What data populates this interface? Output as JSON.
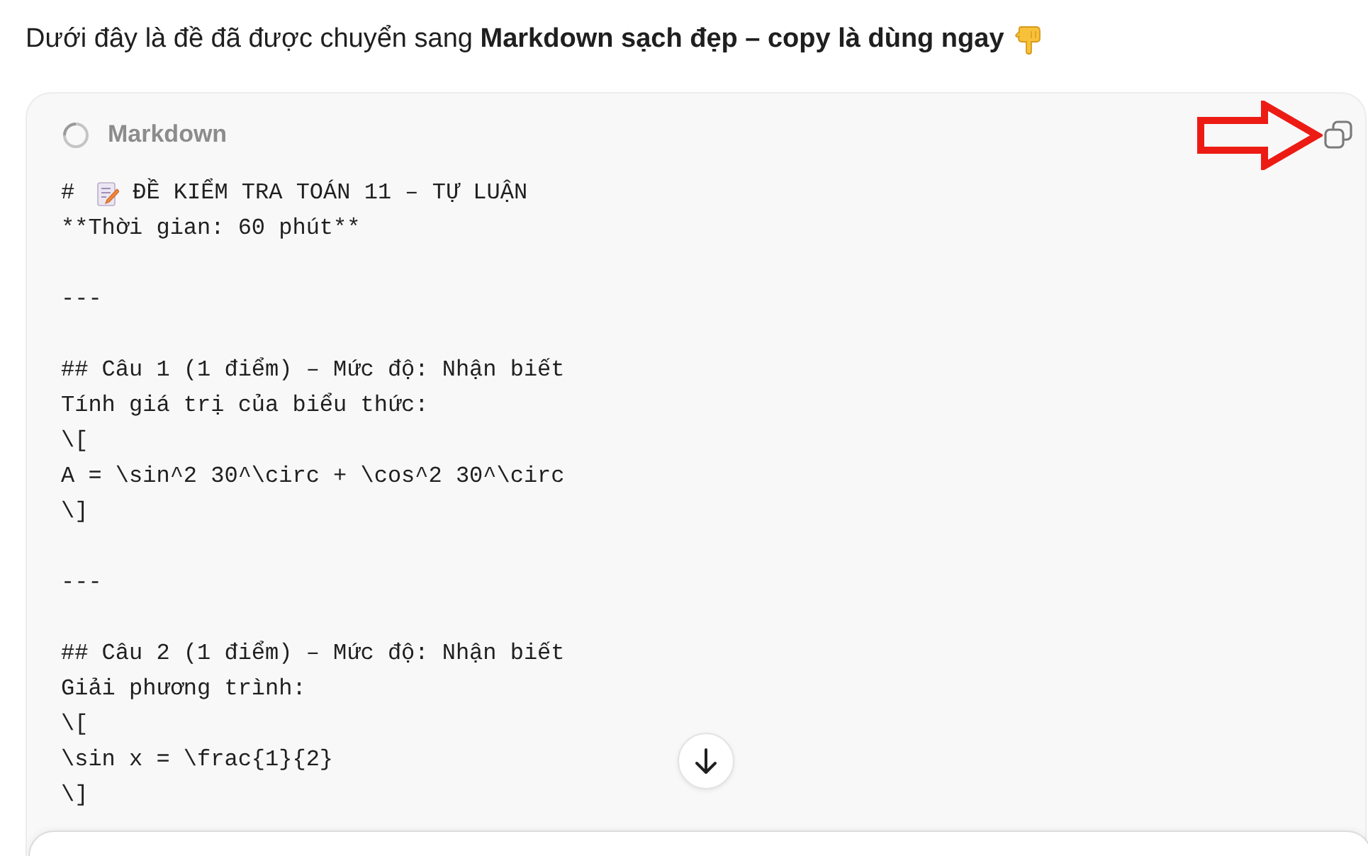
{
  "intro": {
    "text": "Dưới đây là đề đã được chuyển sang **Markdown sạch đẹp – copy là dùng ngay**"
  },
  "code_block": {
    "language": "Markdown",
    "lines": [
      {
        "kind": "heading",
        "marker": "#",
        "text": "ĐỀ KIỂM TRA TOÁN 11 – TỰ LUẬN"
      },
      {
        "kind": "text",
        "text": "**Thời gian: 60 phút**"
      },
      {
        "kind": "blank"
      },
      {
        "kind": "text",
        "text": "---"
      },
      {
        "kind": "blank"
      },
      {
        "kind": "text",
        "text": "## Câu 1 (1 điểm) – Mức độ: Nhận biết"
      },
      {
        "kind": "text",
        "text": "Tính giá trị của biểu thức:"
      },
      {
        "kind": "text",
        "text": "\\["
      },
      {
        "kind": "text",
        "text": "A = \\sin^2 30^\\circ + \\cos^2 30^\\circ"
      },
      {
        "kind": "text",
        "text": "\\]"
      },
      {
        "kind": "blank"
      },
      {
        "kind": "text",
        "text": "---"
      },
      {
        "kind": "blank"
      },
      {
        "kind": "text",
        "text": "## Câu 2 (1 điểm) – Mức độ: Nhận biết"
      },
      {
        "kind": "text",
        "text": "Giải phương trình:"
      },
      {
        "kind": "text",
        "text": "\\["
      },
      {
        "kind": "text",
        "text": "\\sin x = \\frac{1}{2}"
      },
      {
        "kind": "text",
        "text": "\\]"
      }
    ]
  }
}
